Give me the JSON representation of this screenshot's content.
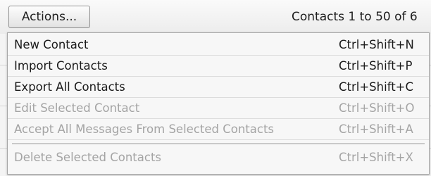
{
  "toolbar": {
    "actions_label": "Actions...",
    "contacts_count": "Contacts 1 to 50 of 6"
  },
  "menu": {
    "items": [
      {
        "label": "New Contact",
        "shortcut": "Ctrl+Shift+N",
        "enabled": true
      },
      {
        "label": "Import Contacts",
        "shortcut": "Ctrl+Shift+P",
        "enabled": true
      },
      {
        "label": "Export All Contacts",
        "shortcut": "Ctrl+Shift+C",
        "enabled": true
      },
      {
        "label": "Edit Selected Contact",
        "shortcut": "Ctrl+Shift+O",
        "enabled": false
      },
      {
        "label": "Accept All Messages From Selected Contacts",
        "shortcut": "Ctrl+Shift+A",
        "enabled": false
      },
      {
        "label": "Delete Selected Contacts",
        "shortcut": "Ctrl+Shift+X",
        "enabled": false
      }
    ]
  }
}
